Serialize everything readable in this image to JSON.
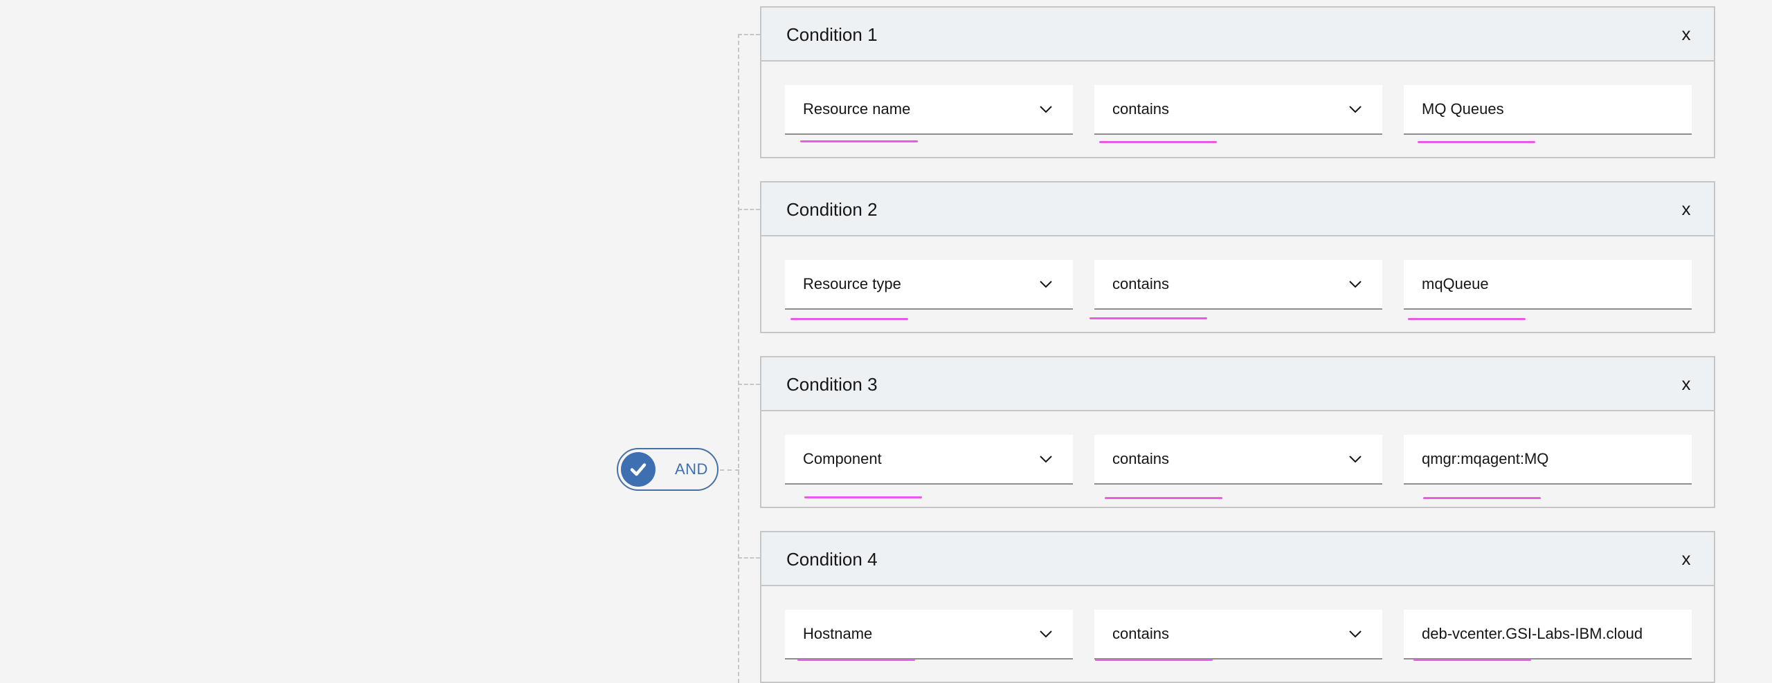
{
  "and_toggle": {
    "label": "AND",
    "checked": true,
    "accent_color": "#3e6fb0"
  },
  "conditions": [
    {
      "title": "Condition 1",
      "close_label": "x",
      "field": "Resource name",
      "operator": "contains",
      "value": "MQ Queues"
    },
    {
      "title": "Condition 2",
      "close_label": "x",
      "field": "Resource type",
      "operator": "contains",
      "value": "mqQueue"
    },
    {
      "title": "Condition 3",
      "close_label": "x",
      "field": "Component",
      "operator": "contains",
      "value": "qmgr:mqagent:MQ"
    },
    {
      "title": "Condition 4",
      "close_label": "x",
      "field": "Hostname",
      "operator": "contains",
      "value": "deb-vcenter.GSI-Labs-IBM.cloud"
    }
  ],
  "icons": {
    "dropdown": "chevron-down-icon",
    "toggle": "checkmark-icon",
    "remove": "close-icon"
  },
  "colors": {
    "annotation_underline": "#e65ce6",
    "card_border": "#c6c6c6",
    "header_bg": "#eef1f4"
  }
}
